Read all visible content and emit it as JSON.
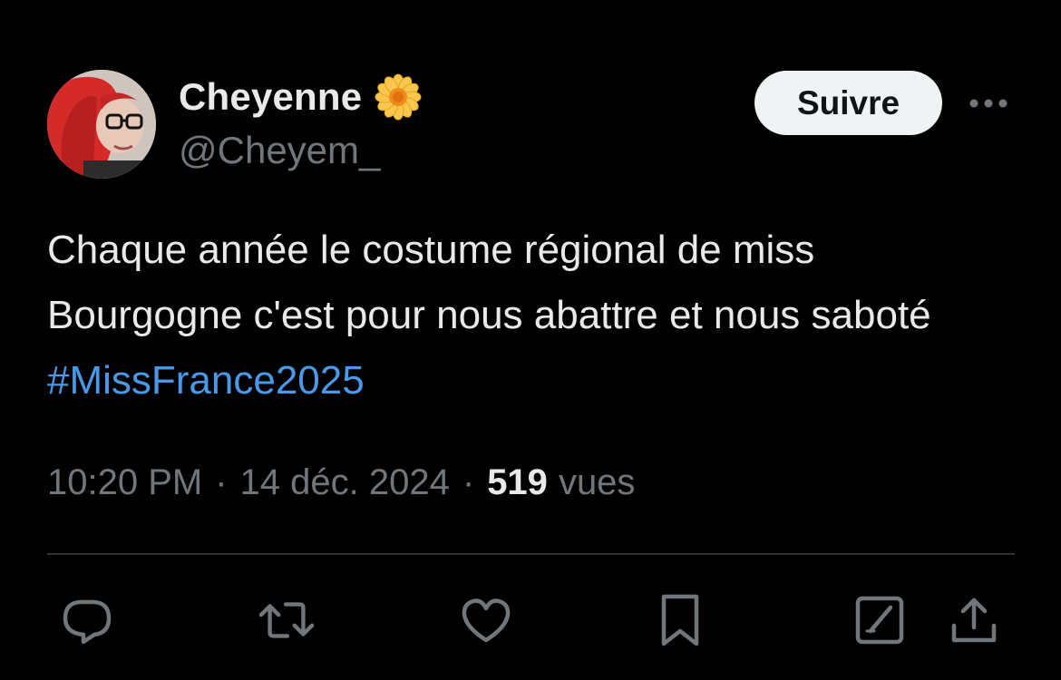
{
  "author": {
    "display_name": "Cheyenne",
    "handle": "@Cheyem_",
    "badge_icon": "sunflower-emoji-icon",
    "avatar_icon": "avatar-photo"
  },
  "follow_button": {
    "label": "Suivre"
  },
  "more_icon": "more-dots-icon",
  "tweet": {
    "text": "Chaque année le costume régional de miss Bourgogne c'est pour nous abattre et nous saboté ",
    "hashtag": "#MissFrance2025"
  },
  "meta": {
    "time": "10:20 PM",
    "separator": "·",
    "date": "14 déc. 2024",
    "views_count": "519",
    "views_label": "vues"
  },
  "actions": [
    {
      "icon": "reply-icon"
    },
    {
      "icon": "retweet-icon"
    },
    {
      "icon": "like-icon"
    },
    {
      "icon": "bookmark-icon"
    },
    {
      "icon": "grok-icon"
    },
    {
      "icon": "share-icon"
    }
  ],
  "colors": {
    "background": "#000000",
    "text_primary": "#e7e9ea",
    "text_secondary": "#71767b",
    "link": "#4a99e9",
    "divider": "#2f3336",
    "follow_bg": "#eff3f4",
    "follow_text": "#0f1419"
  }
}
